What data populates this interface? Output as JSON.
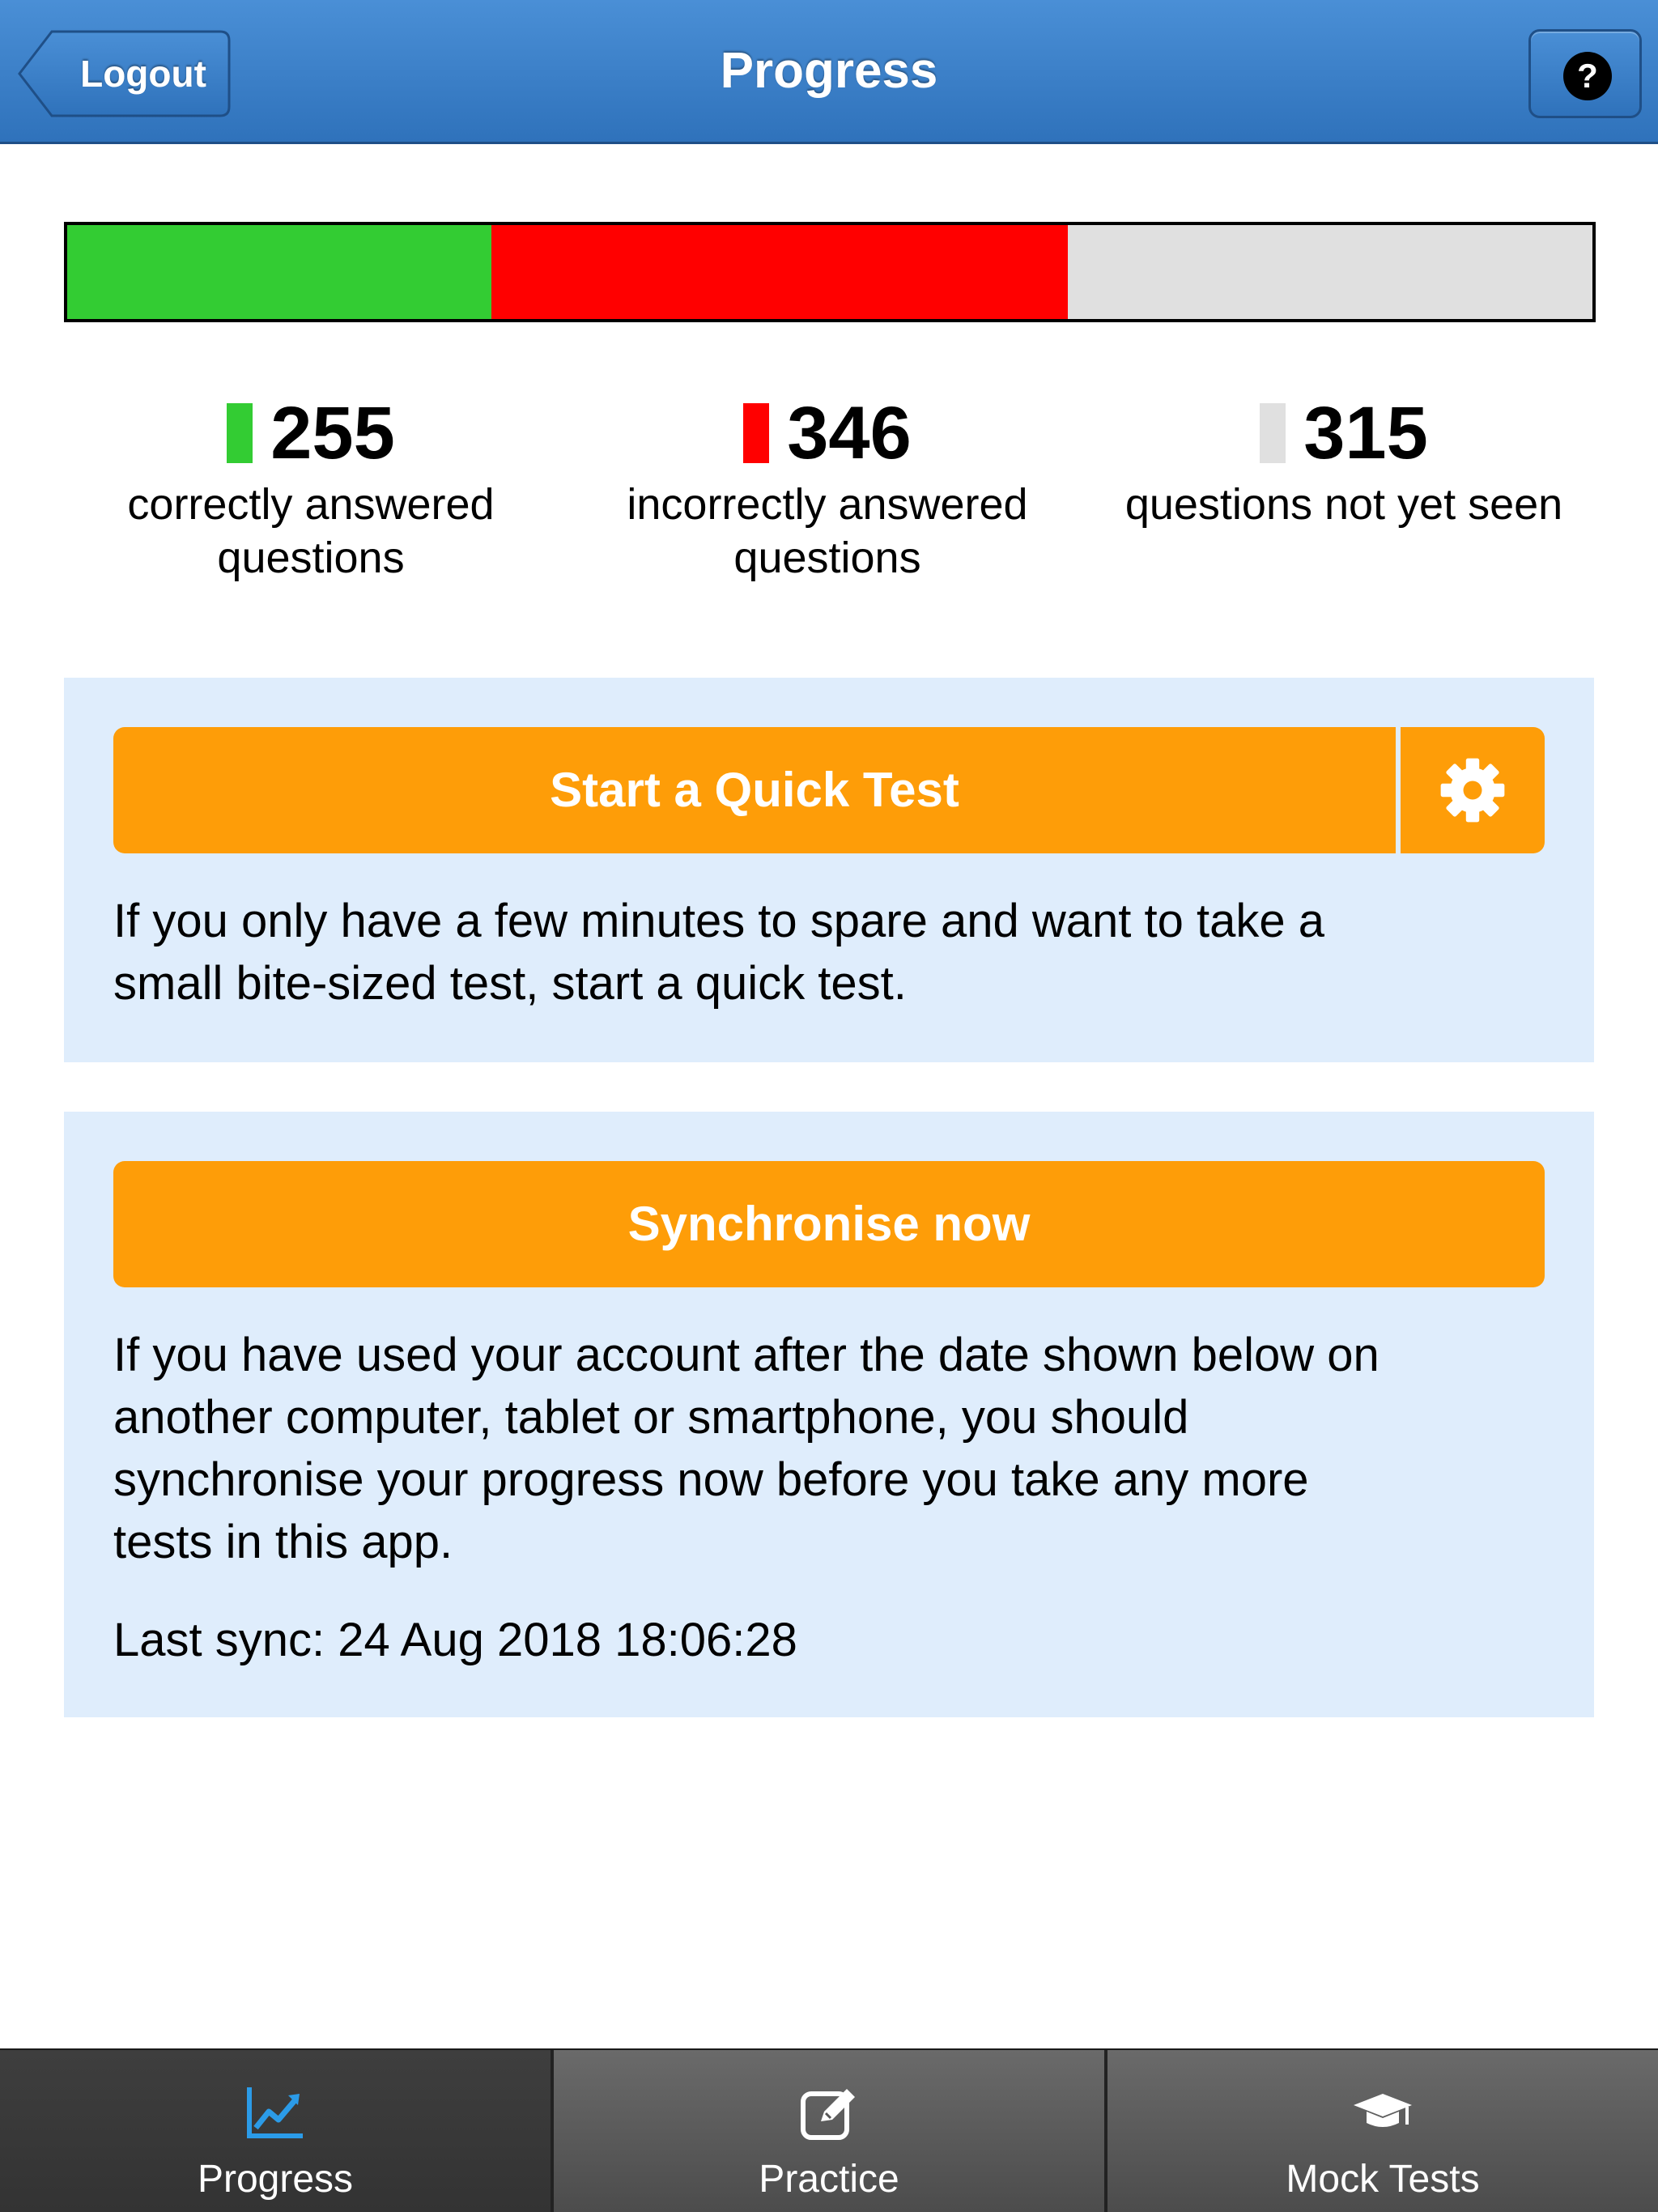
{
  "header": {
    "title": "Progress",
    "logout_label": "Logout",
    "help_icon": "question-circle-icon"
  },
  "progress": {
    "correct": {
      "count": "255",
      "label_line1": "correctly answered",
      "label_line2": "questions",
      "color": "#33cc33",
      "value": 255
    },
    "incorrect": {
      "count": "346",
      "label_line1": "incorrectly answered",
      "label_line2": "questions",
      "color": "#ff0000",
      "value": 346
    },
    "unseen": {
      "count": "315",
      "label_line1": "questions not yet seen",
      "label_line2": "",
      "color": "#e0e0e0",
      "value": 315
    }
  },
  "quick_test": {
    "button_label": "Start a Quick Test",
    "settings_icon": "gear-icon",
    "description_line1": "If you only have a few minutes to spare and want to take a",
    "description_line2": "small bite-sized test, start a quick test."
  },
  "sync": {
    "button_label": "Synchronise now",
    "description_line1": "If you have used your account after the date shown below on",
    "description_line2": "another computer, tablet or smartphone, you should",
    "description_line3": "synchronise your progress now before you take any more",
    "description_line4": "tests in this app.",
    "last_sync": "Last sync: 24 Aug 2018 18:06:28"
  },
  "tabs": [
    {
      "label": "Progress",
      "icon": "chart-line-icon",
      "active": true
    },
    {
      "label": "Practice",
      "icon": "edit-icon",
      "active": false
    },
    {
      "label": "Mock Tests",
      "icon": "graduation-cap-icon",
      "active": false
    }
  ],
  "colors": {
    "header_blue": "#2f72bb",
    "accent_orange": "#fe9d08",
    "panel_bg": "#dfedfc",
    "active_tab_icon": "#2b9be8"
  }
}
